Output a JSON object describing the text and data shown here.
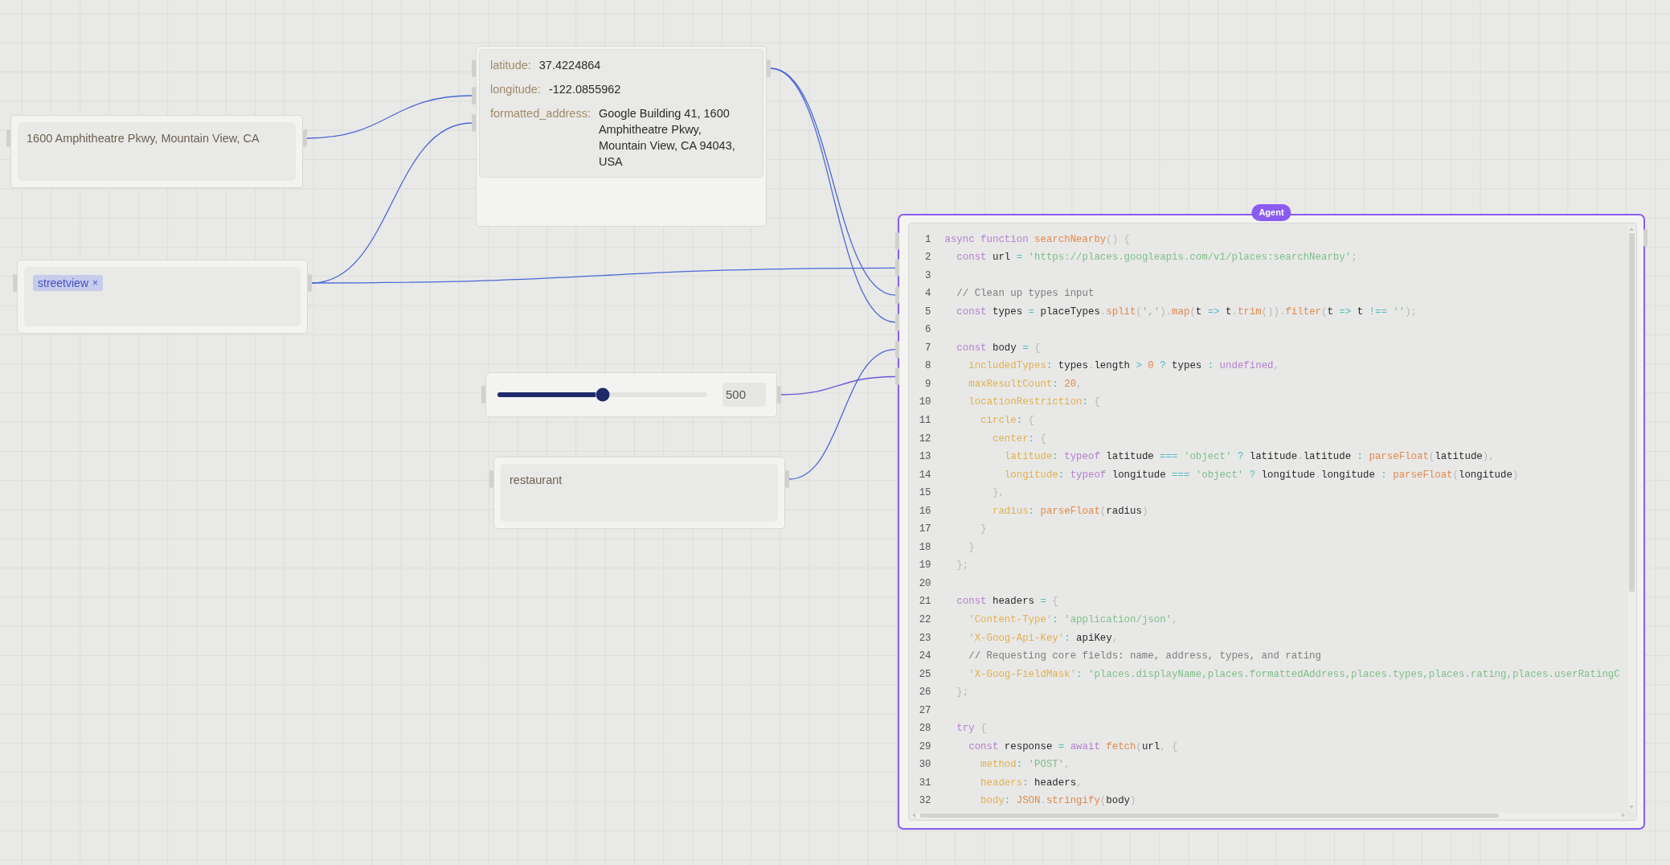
{
  "canvas": {
    "nodes": [
      {
        "kind": "text",
        "value": "1600 Amphitheatre Pkwy, Mountain View, CA"
      },
      {
        "kind": "tags",
        "tags": [
          {
            "label": "streetview",
            "remove": "×"
          }
        ]
      },
      {
        "kind": "fields",
        "fields": [
          {
            "label": "latitude:",
            "value": "37.4224864"
          },
          {
            "label": "longitude:",
            "value": "-122.0855962"
          },
          {
            "label": "formatted_address:",
            "value": "Google Building 41, 1600 Amphitheatre Pkwy, Mountain View, CA 94043, USA"
          }
        ]
      },
      {
        "kind": "slider",
        "level": 0.5,
        "value": "500"
      },
      {
        "kind": "text",
        "value": "restaurant"
      },
      {
        "kind": "code",
        "badge": "Agent",
        "lines": [
          {
            "number": "1",
            "tokens": [
              {
                "text": "async function ",
                "kind": "keyword"
              },
              {
                "text": "searchNearby",
                "kind": "function"
              },
              {
                "text": "() {",
                "kind": "punct"
              }
            ]
          },
          {
            "number": "2",
            "tokens": [
              {
                "text": "  const ",
                "kind": "keyword"
              },
              {
                "text": "url ",
                "kind": "plain"
              },
              {
                "text": "= ",
                "kind": "operator"
              },
              {
                "text": "'https://places.googleapis.com/v1/places:searchNearby'",
                "kind": "string"
              },
              {
                "text": ";",
                "kind": "punct"
              }
            ]
          },
          {
            "number": "3"
          },
          {
            "number": "4",
            "tokens": [
              {
                "text": "  // Clean up types input",
                "kind": "comment"
              }
            ]
          },
          {
            "number": "5",
            "tokens": [
              {
                "text": "  const ",
                "kind": "keyword"
              },
              {
                "text": "types ",
                "kind": "plain"
              },
              {
                "text": "= ",
                "kind": "operator"
              },
              {
                "text": "placeTypes",
                "kind": "plain"
              },
              {
                "text": ".",
                "kind": "punct"
              },
              {
                "text": "split",
                "kind": "function"
              },
              {
                "text": "(",
                "kind": "punct"
              },
              {
                "text": "','",
                "kind": "string"
              },
              {
                "text": ").",
                "kind": "punct"
              },
              {
                "text": "map",
                "kind": "function"
              },
              {
                "text": "(",
                "kind": "punct"
              },
              {
                "text": "t ",
                "kind": "plain"
              },
              {
                "text": "=> ",
                "kind": "operator"
              },
              {
                "text": "t",
                "kind": "plain"
              },
              {
                "text": ".",
                "kind": "punct"
              },
              {
                "text": "trim",
                "kind": "function"
              },
              {
                "text": "()).",
                "kind": "punct"
              },
              {
                "text": "filter",
                "kind": "function"
              },
              {
                "text": "(",
                "kind": "punct"
              },
              {
                "text": "t ",
                "kind": "plain"
              },
              {
                "text": "=> ",
                "kind": "operator"
              },
              {
                "text": "t ",
                "kind": "plain"
              },
              {
                "text": "!== ",
                "kind": "operator"
              },
              {
                "text": "''",
                "kind": "string"
              },
              {
                "text": ");",
                "kind": "punct"
              }
            ]
          },
          {
            "number": "6"
          },
          {
            "number": "7",
            "tokens": [
              {
                "text": "  const ",
                "kind": "keyword"
              },
              {
                "text": "body ",
                "kind": "plain"
              },
              {
                "text": "= ",
                "kind": "operator"
              },
              {
                "text": "{",
                "kind": "punct"
              }
            ]
          },
          {
            "number": "8",
            "tokens": [
              {
                "text": "    includedTypes",
                "kind": "key"
              },
              {
                "text": ": ",
                "kind": "operator"
              },
              {
                "text": "types",
                "kind": "plain"
              },
              {
                "text": ".",
                "kind": "punct"
              },
              {
                "text": "length ",
                "kind": "plain"
              },
              {
                "text": "> ",
                "kind": "operator"
              },
              {
                "text": "0 ",
                "kind": "number"
              },
              {
                "text": "? ",
                "kind": "operator"
              },
              {
                "text": "types ",
                "kind": "plain"
              },
              {
                "text": ": ",
                "kind": "operator"
              },
              {
                "text": "undefined",
                "kind": "keyword"
              },
              {
                "text": ",",
                "kind": "punct"
              }
            ]
          },
          {
            "number": "9",
            "tokens": [
              {
                "text": "    maxResultCount",
                "kind": "key"
              },
              {
                "text": ": ",
                "kind": "operator"
              },
              {
                "text": "20",
                "kind": "number"
              },
              {
                "text": ",",
                "kind": "punct"
              }
            ]
          },
          {
            "number": "10",
            "tokens": [
              {
                "text": "    locationRestriction",
                "kind": "key"
              },
              {
                "text": ": ",
                "kind": "operator"
              },
              {
                "text": "{",
                "kind": "punct"
              }
            ]
          },
          {
            "number": "11",
            "tokens": [
              {
                "text": "      circle",
                "kind": "key"
              },
              {
                "text": ": ",
                "kind": "operator"
              },
              {
                "text": "{",
                "kind": "punct"
              }
            ]
          },
          {
            "number": "12",
            "tokens": [
              {
                "text": "        center",
                "kind": "key"
              },
              {
                "text": ": ",
                "kind": "operator"
              },
              {
                "text": "{",
                "kind": "punct"
              }
            ]
          },
          {
            "number": "13",
            "tokens": [
              {
                "text": "          latitude",
                "kind": "key"
              },
              {
                "text": ": ",
                "kind": "operator"
              },
              {
                "text": "typeof ",
                "kind": "keyword"
              },
              {
                "text": "latitude ",
                "kind": "plain"
              },
              {
                "text": "=== ",
                "kind": "operator"
              },
              {
                "text": "'object' ",
                "kind": "string"
              },
              {
                "text": "? ",
                "kind": "operator"
              },
              {
                "text": "latitude",
                "kind": "plain"
              },
              {
                "text": ".",
                "kind": "punct"
              },
              {
                "text": "latitude ",
                "kind": "plain"
              },
              {
                "text": ": ",
                "kind": "operator"
              },
              {
                "text": "parseFloat",
                "kind": "function"
              },
              {
                "text": "(",
                "kind": "punct"
              },
              {
                "text": "latitude",
                "kind": "plain"
              },
              {
                "text": "),",
                "kind": "punct"
              }
            ]
          },
          {
            "number": "14",
            "tokens": [
              {
                "text": "          longitude",
                "kind": "key"
              },
              {
                "text": ": ",
                "kind": "operator"
              },
              {
                "text": "typeof ",
                "kind": "keyword"
              },
              {
                "text": "longitude ",
                "kind": "plain"
              },
              {
                "text": "=== ",
                "kind": "operator"
              },
              {
                "text": "'object' ",
                "kind": "string"
              },
              {
                "text": "? ",
                "kind": "operator"
              },
              {
                "text": "longitude",
                "kind": "plain"
              },
              {
                "text": ".",
                "kind": "punct"
              },
              {
                "text": "longitude ",
                "kind": "plain"
              },
              {
                "text": ": ",
                "kind": "operator"
              },
              {
                "text": "parseFloat",
                "kind": "function"
              },
              {
                "text": "(",
                "kind": "punct"
              },
              {
                "text": "longitude",
                "kind": "plain"
              },
              {
                "text": ")",
                "kind": "punct"
              }
            ]
          },
          {
            "number": "15",
            "tokens": [
              {
                "text": "        },",
                "kind": "punct"
              }
            ]
          },
          {
            "number": "16",
            "tokens": [
              {
                "text": "        radius",
                "kind": "key"
              },
              {
                "text": ": ",
                "kind": "operator"
              },
              {
                "text": "parseFloat",
                "kind": "function"
              },
              {
                "text": "(",
                "kind": "punct"
              },
              {
                "text": "radius",
                "kind": "plain"
              },
              {
                "text": ")",
                "kind": "punct"
              }
            ]
          },
          {
            "number": "17",
            "tokens": [
              {
                "text": "      }",
                "kind": "punct"
              }
            ]
          },
          {
            "number": "18",
            "tokens": [
              {
                "text": "    }",
                "kind": "punct"
              }
            ]
          },
          {
            "number": "19",
            "tokens": [
              {
                "text": "  };",
                "kind": "punct"
              }
            ]
          },
          {
            "number": "20"
          },
          {
            "number": "21",
            "tokens": [
              {
                "text": "  const ",
                "kind": "keyword"
              },
              {
                "text": "headers ",
                "kind": "plain"
              },
              {
                "text": "= ",
                "kind": "operator"
              },
              {
                "text": "{",
                "kind": "punct"
              }
            ]
          },
          {
            "number": "22",
            "tokens": [
              {
                "text": "    'Content-Type'",
                "kind": "key"
              },
              {
                "text": ": ",
                "kind": "operator"
              },
              {
                "text": "'application/json'",
                "kind": "string"
              },
              {
                "text": ",",
                "kind": "punct"
              }
            ]
          },
          {
            "number": "23",
            "tokens": [
              {
                "text": "    'X-Goog-Api-Key'",
                "kind": "key"
              },
              {
                "text": ": ",
                "kind": "operator"
              },
              {
                "text": "apiKey",
                "kind": "plain"
              },
              {
                "text": ",",
                "kind": "punct"
              }
            ]
          },
          {
            "number": "24",
            "tokens": [
              {
                "text": "    // Requesting core fields: name, address, types, and rating",
                "kind": "comment"
              }
            ]
          },
          {
            "number": "25",
            "tokens": [
              {
                "text": "    'X-Goog-FieldMask'",
                "kind": "key"
              },
              {
                "text": ": ",
                "kind": "operator"
              },
              {
                "text": "'places.displayName,places.formattedAddress,places.types,places.rating,places.userRatingC",
                "kind": "string"
              }
            ]
          },
          {
            "number": "26",
            "tokens": [
              {
                "text": "  };",
                "kind": "punct"
              }
            ]
          },
          {
            "number": "27"
          },
          {
            "number": "28",
            "tokens": [
              {
                "text": "  try ",
                "kind": "keyword"
              },
              {
                "text": "{",
                "kind": "punct"
              }
            ]
          },
          {
            "number": "29",
            "tokens": [
              {
                "text": "    const ",
                "kind": "keyword"
              },
              {
                "text": "response ",
                "kind": "plain"
              },
              {
                "text": "= ",
                "kind": "operator"
              },
              {
                "text": "await ",
                "kind": "keyword"
              },
              {
                "text": "fetch",
                "kind": "function"
              },
              {
                "text": "(",
                "kind": "punct"
              },
              {
                "text": "url",
                "kind": "plain"
              },
              {
                "text": ", {",
                "kind": "punct"
              }
            ]
          },
          {
            "number": "30",
            "tokens": [
              {
                "text": "      method",
                "kind": "key"
              },
              {
                "text": ": ",
                "kind": "operator"
              },
              {
                "text": "'POST'",
                "kind": "string"
              },
              {
                "text": ",",
                "kind": "punct"
              }
            ]
          },
          {
            "number": "31",
            "tokens": [
              {
                "text": "      headers",
                "kind": "key"
              },
              {
                "text": ": ",
                "kind": "operator"
              },
              {
                "text": "headers",
                "kind": "plain"
              },
              {
                "text": ",",
                "kind": "punct"
              }
            ]
          },
          {
            "number": "32",
            "tokens": [
              {
                "text": "      body",
                "kind": "key"
              },
              {
                "text": ": ",
                "kind": "operator"
              },
              {
                "text": "JSON",
                "kind": "function"
              },
              {
                "text": ".",
                "kind": "punct"
              },
              {
                "text": "stringify",
                "kind": "function"
              },
              {
                "text": "(",
                "kind": "punct"
              },
              {
                "text": "body",
                "kind": "plain"
              },
              {
                "text": ")",
                "kind": "punct"
              }
            ]
          }
        ]
      }
    ]
  }
}
